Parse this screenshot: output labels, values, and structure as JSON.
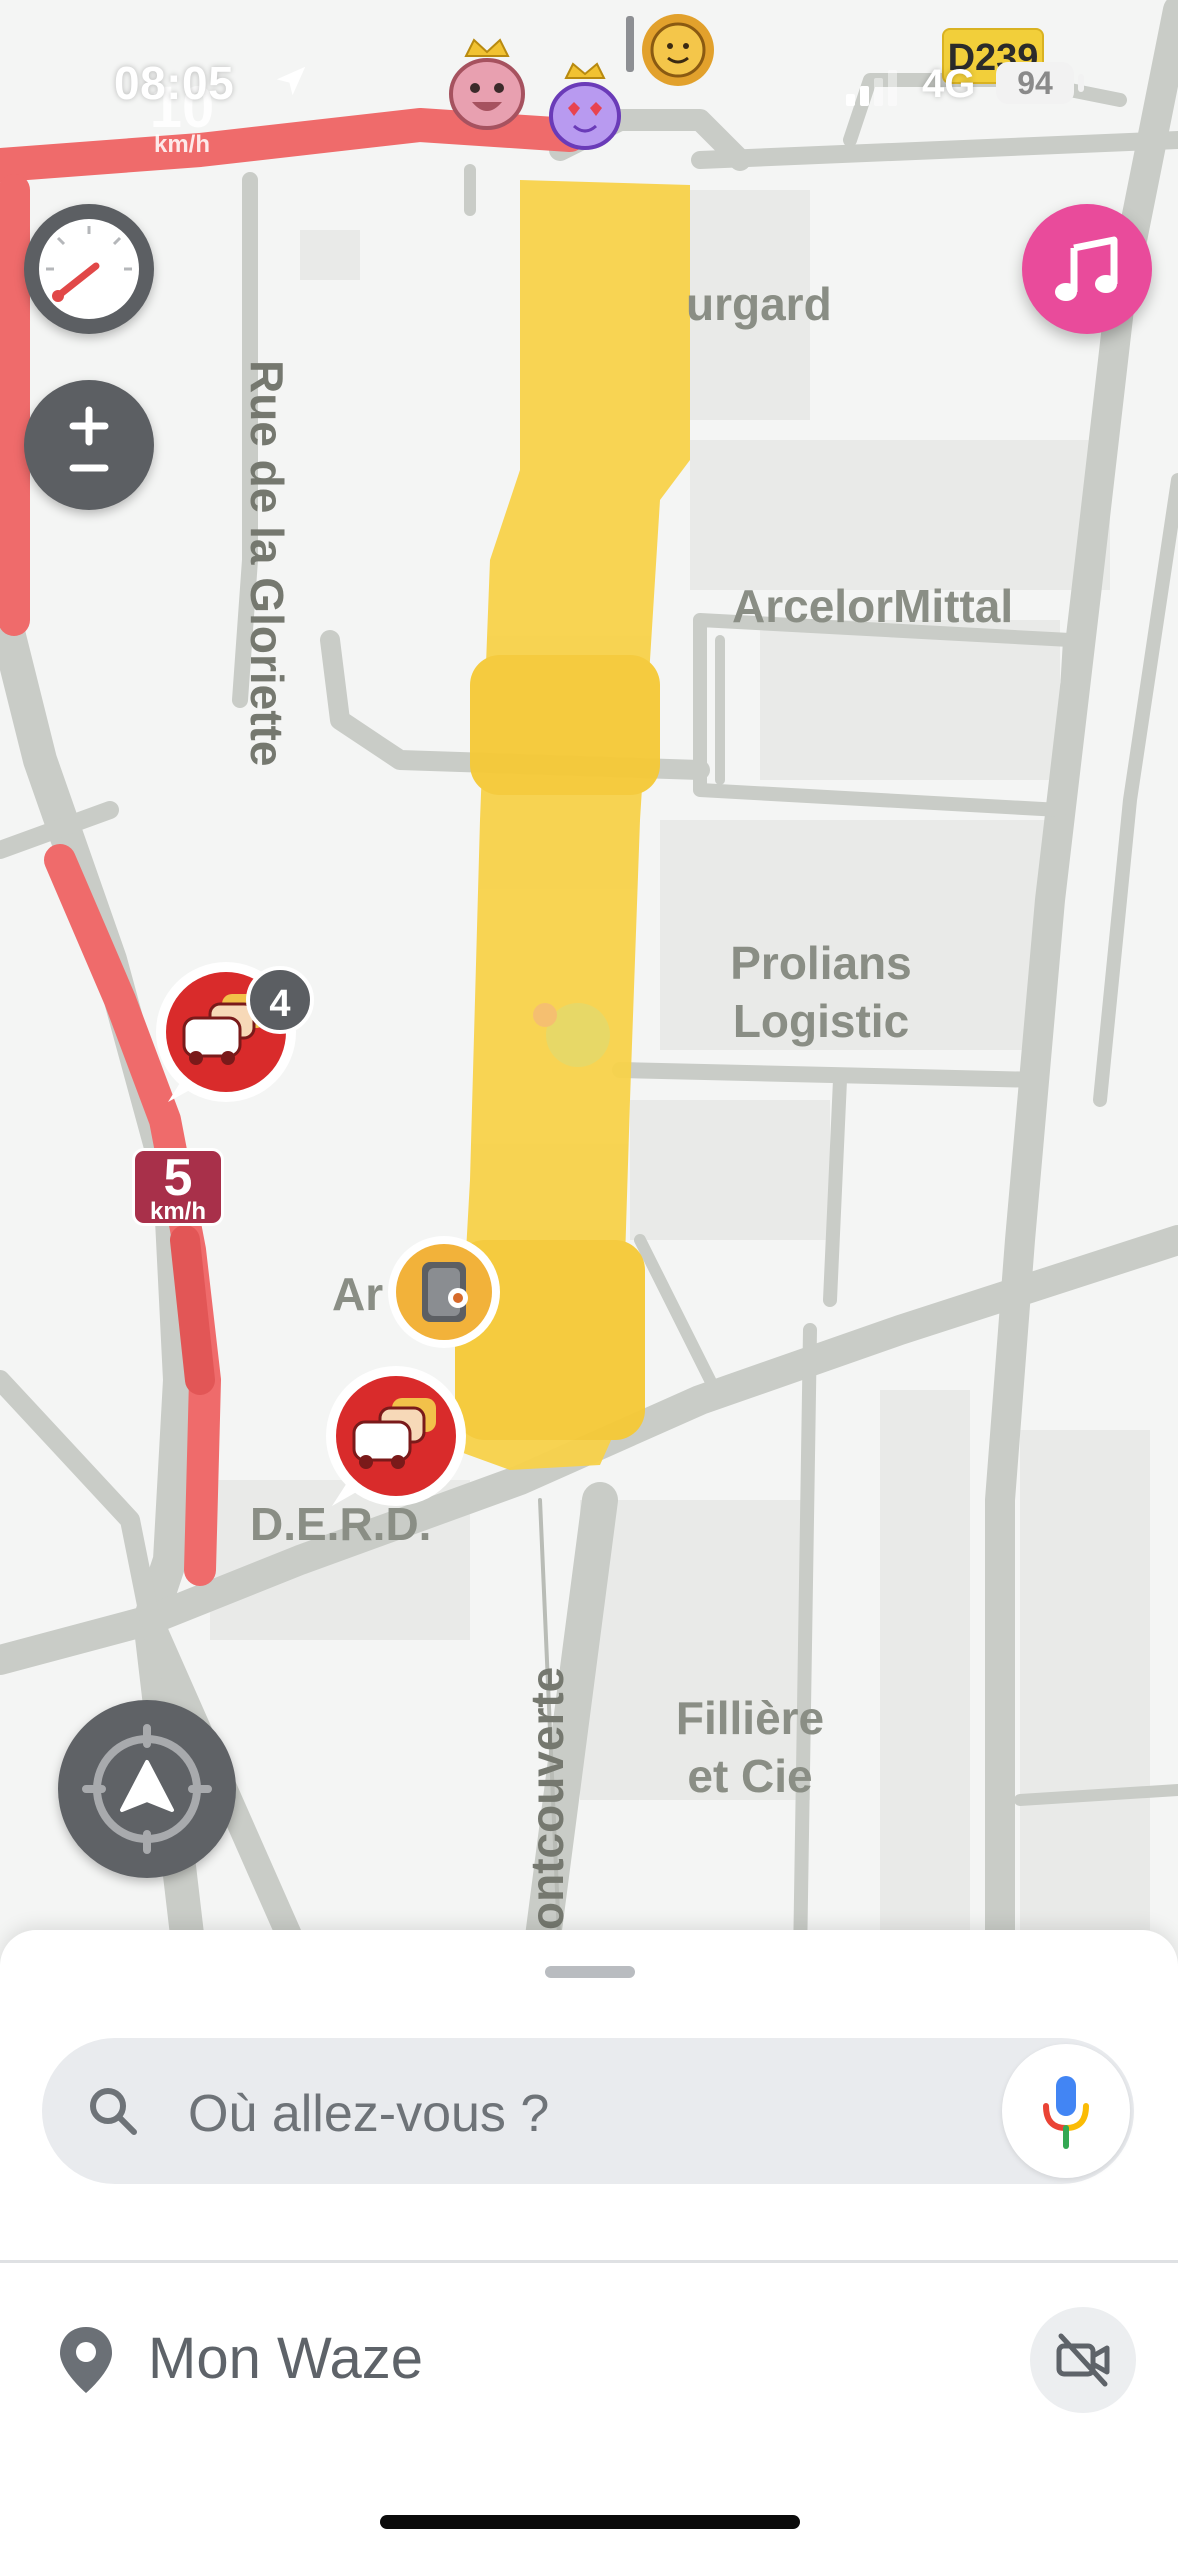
{
  "status_bar": {
    "time": "08:05",
    "network": "4G",
    "battery": "94"
  },
  "map": {
    "road_shield": "D239",
    "faded_speed_value": "10",
    "faded_speed_unit": "km/h",
    "place_labels": {
      "burgard": "urgard",
      "arcelor": "ArcelorMittal",
      "prolians_line1": "Prolians",
      "prolians_line2": "Logistic",
      "ar": "Ar",
      "derd": "D.E.R.D.",
      "filliere_line1": "Fillière",
      "filliere_line2": "et Cie"
    },
    "street_labels": {
      "gloriette": "Rue de la Gloriette",
      "montcouverte": "ontcouverte"
    },
    "jam_count": "4",
    "speed_sign": {
      "value": "5",
      "unit": "km/h"
    },
    "colors": {
      "traffic_red": "#ef6b6b",
      "highlight_yellow": "#f8d24a",
      "jam_icon_red": "#d92b2b",
      "music_pink": "#e94b9b"
    }
  },
  "bottom_sheet": {
    "search_placeholder": "Où allez-vous ?",
    "my_waze_label": "Mon Waze"
  },
  "icons": {
    "location_arrow": "location-arrow-icon",
    "speedometer": "speedometer-icon",
    "zoom": "zoom-in-out-icon",
    "music": "music-note-icon",
    "recenter": "recenter-icon",
    "search": "search-icon",
    "mic": "microphone-icon",
    "pin": "location-pin-icon",
    "camera_off": "camera-off-icon"
  }
}
